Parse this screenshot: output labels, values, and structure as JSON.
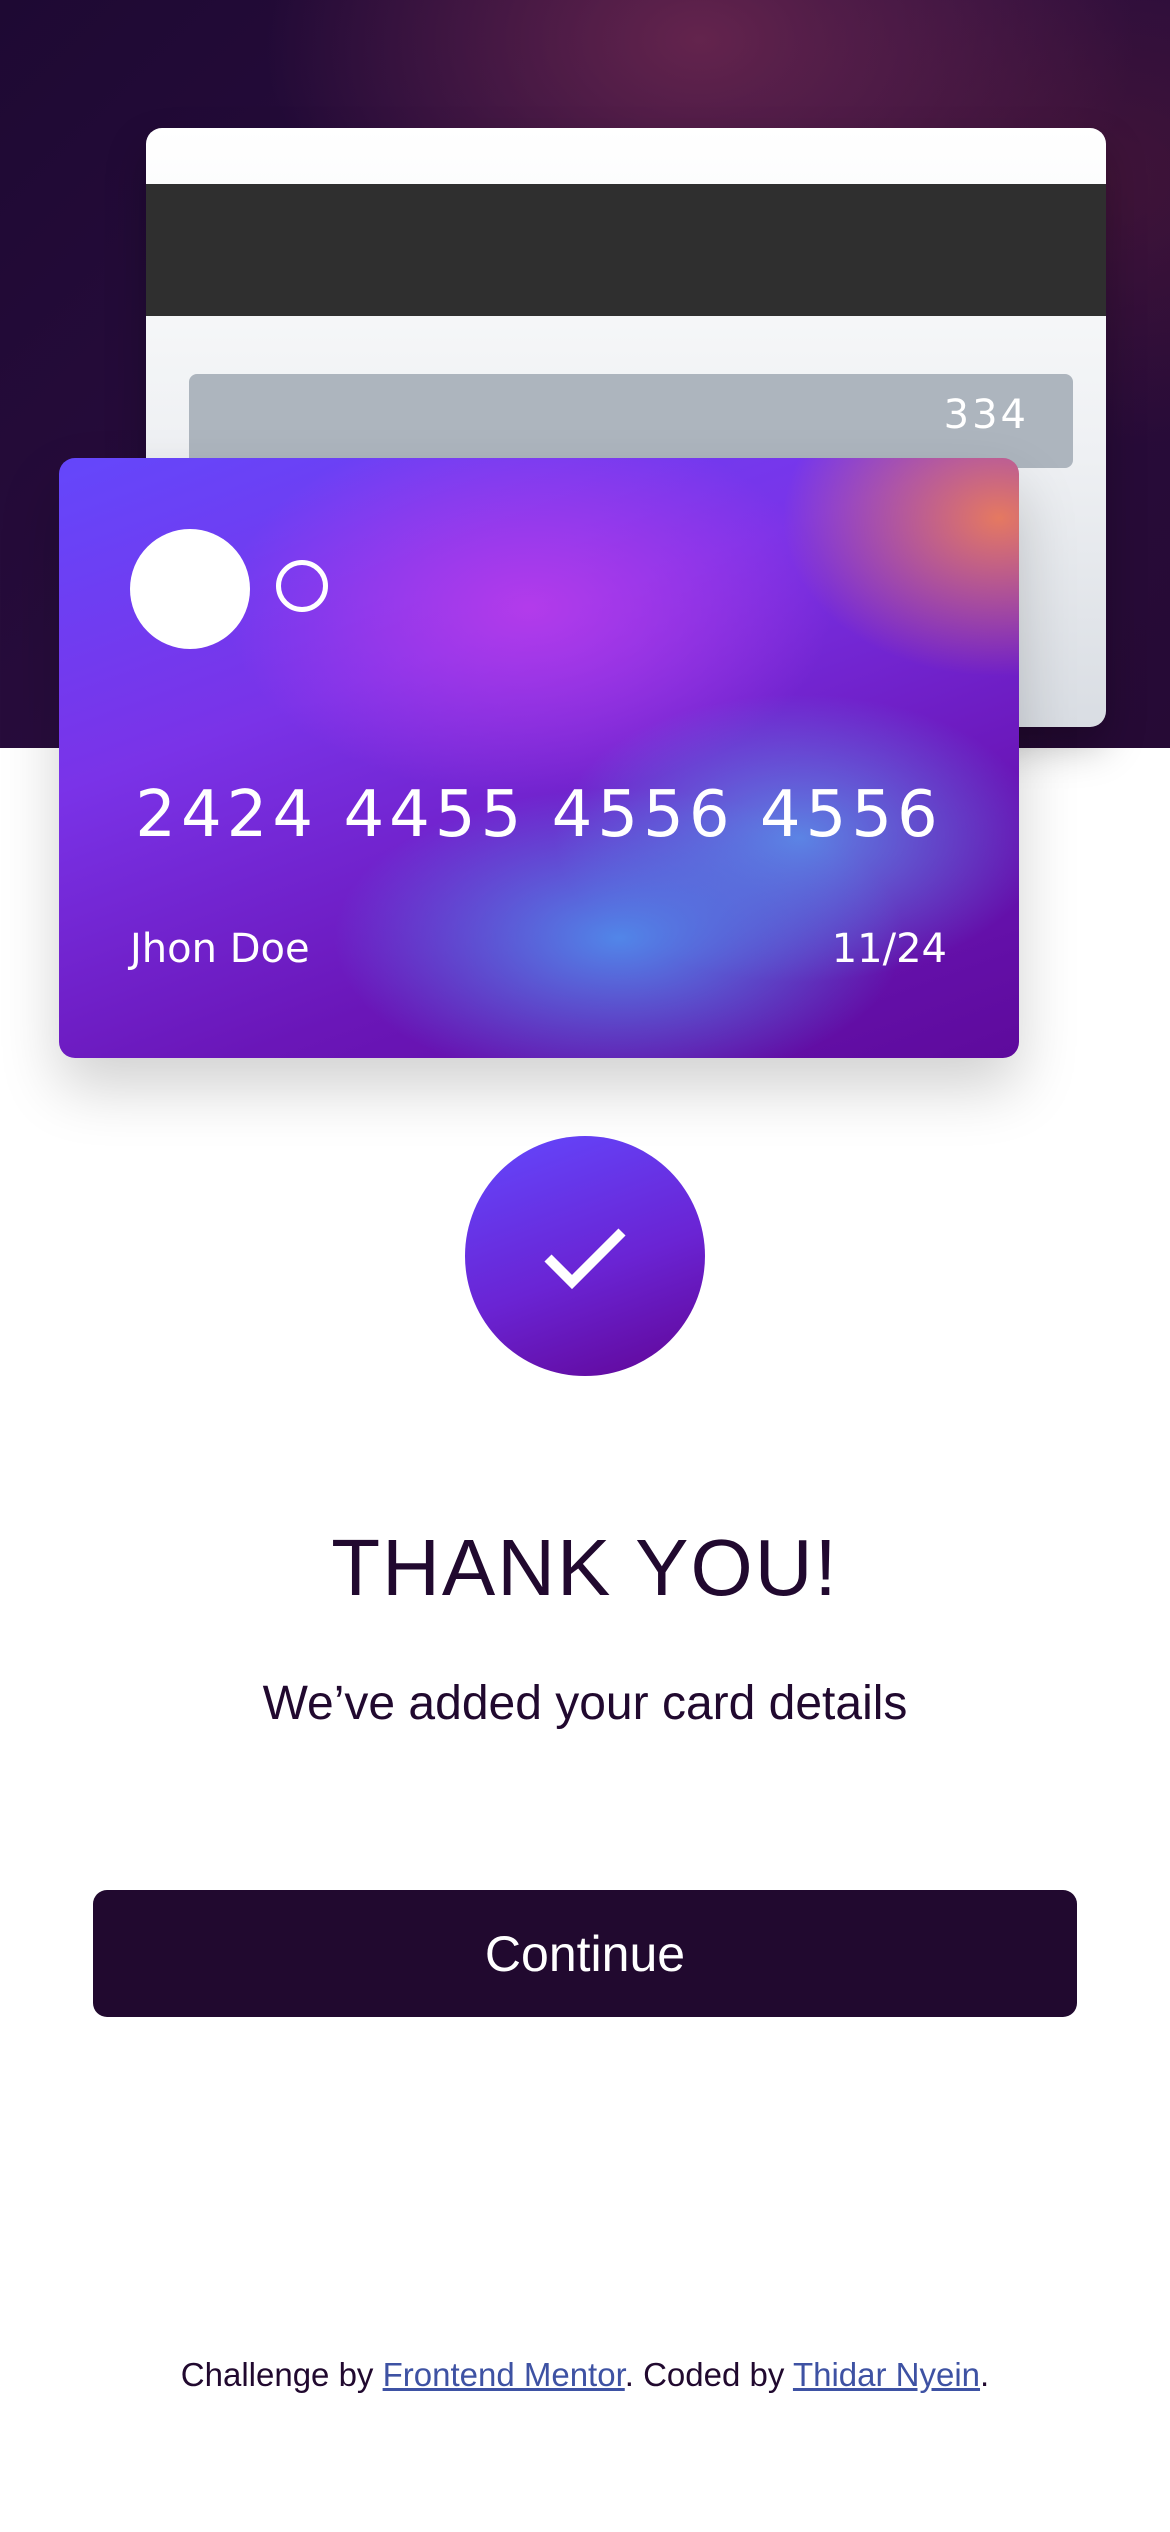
{
  "card_back": {
    "cvc": "334"
  },
  "card_front": {
    "number": "2424 4455 4556 4556",
    "holder_name": "Jhon Doe",
    "expiry": "11/24"
  },
  "success": {
    "title": "THANK YOU!",
    "message": "We’ve added your card details",
    "button_label": "Continue"
  },
  "footer": {
    "prefix": "Challenge by ",
    "link1_text": "Frontend Mentor",
    "middle": ". Coded by ",
    "link2_text": "Thidar Nyein",
    "suffix": "."
  },
  "colors": {
    "dark_violet": "#21092f",
    "accent_start": "#6348fe",
    "accent_end": "#610595",
    "link": "#3e52a3"
  },
  "icons": {
    "check": "check-icon"
  }
}
